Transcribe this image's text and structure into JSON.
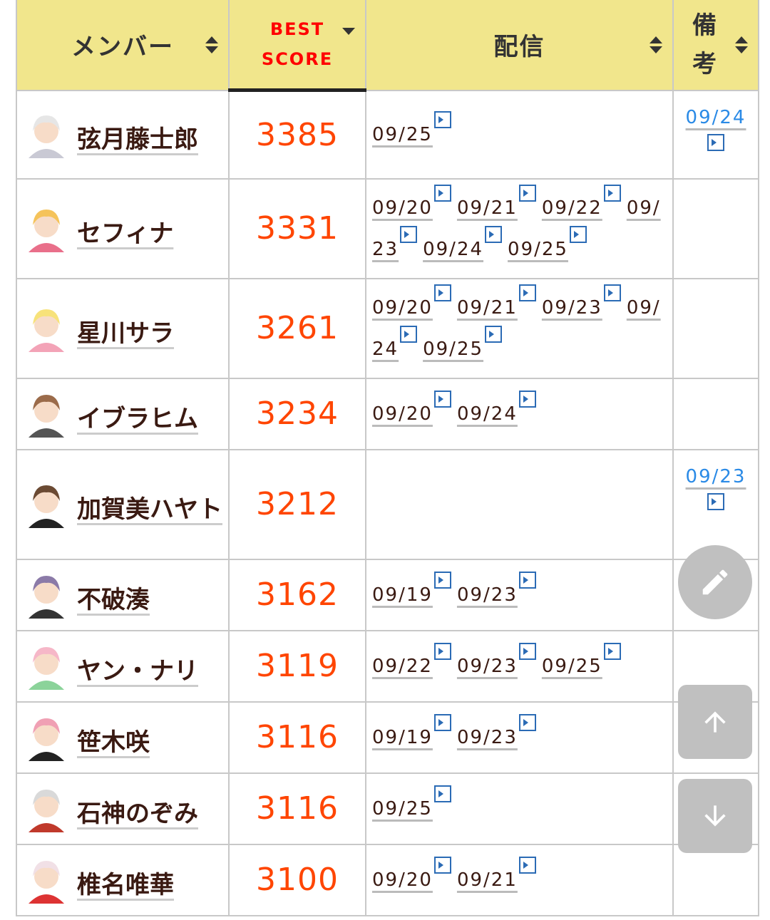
{
  "header": {
    "member_label": "メンバー",
    "best_label_1": "BEST",
    "best_label_2": "SCORE",
    "stream_label": "配信",
    "note_label_1": "備",
    "note_label_2": "考"
  },
  "rows": [
    {
      "name": "弦月藤士郎",
      "score": "3385",
      "streams": [
        "09/25"
      ],
      "note": "09/24"
    },
    {
      "name": "セフィナ",
      "score": "3331",
      "streams": [
        "09/20",
        "09/21",
        "09/22",
        "09/23",
        "09/24",
        "09/25"
      ],
      "note": ""
    },
    {
      "name": "星川サラ",
      "score": "3261",
      "streams": [
        "09/20",
        "09/21",
        "09/23",
        "09/24",
        "09/25"
      ],
      "note": ""
    },
    {
      "name": "イブラヒム",
      "score": "3234",
      "streams": [
        "09/20",
        "09/24"
      ],
      "note": ""
    },
    {
      "name": "加賀美ハヤト",
      "score": "3212",
      "streams": [],
      "note": "09/23"
    },
    {
      "name": "不破湊",
      "score": "3162",
      "streams": [
        "09/19",
        "09/23"
      ],
      "note": ""
    },
    {
      "name": "ヤン・ナリ",
      "score": "3119",
      "streams": [
        "09/22",
        "09/23",
        "09/25"
      ],
      "note": ""
    },
    {
      "name": "笹木咲",
      "score": "3116",
      "streams": [
        "09/19",
        "09/23"
      ],
      "note": ""
    },
    {
      "name": "石神のぞみ",
      "score": "3116",
      "streams": [
        "09/25"
      ],
      "note": ""
    },
    {
      "name": "椎名唯華",
      "score": "3100",
      "streams": [
        "09/20",
        "09/21"
      ],
      "note": ""
    }
  ],
  "fab": {
    "edit_icon": "pencil-icon",
    "up_icon": "arrow-up-icon",
    "down_icon": "arrow-down-icon"
  }
}
